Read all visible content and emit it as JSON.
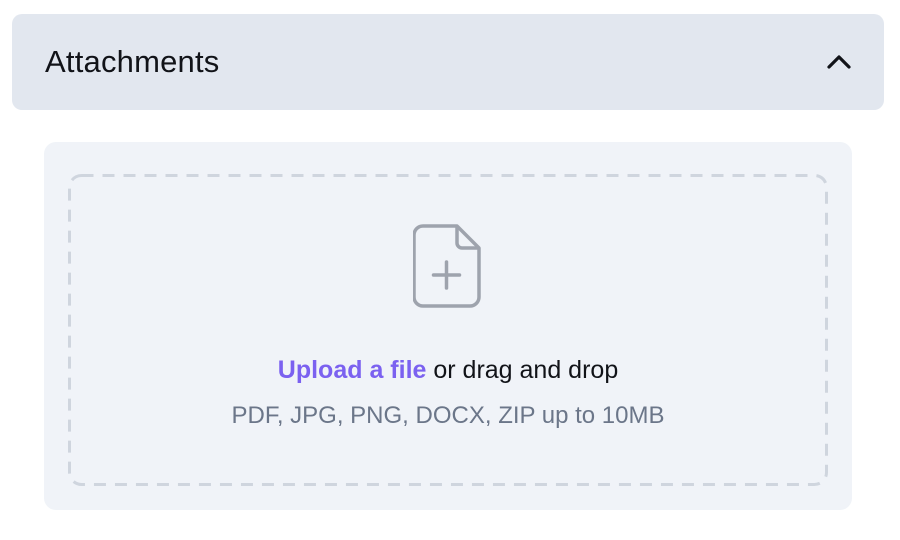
{
  "accordion": {
    "title": "Attachments",
    "toggle_icon": "chevron-up-icon",
    "expanded": true
  },
  "upload": {
    "icon": "file-plus-icon",
    "link_label": "Upload a file",
    "drag_text": " or drag and drop",
    "hint": "PDF, JPG, PNG, DOCX, ZIP up to 10MB"
  },
  "colors": {
    "header_bg": "#e2e7ef",
    "panel_bg": "#f0f3f8",
    "link": "#7b61f0",
    "hint_text": "#6b7689",
    "dashed_border": "#cfd5de",
    "icon_stroke": "#9ea3ad"
  }
}
